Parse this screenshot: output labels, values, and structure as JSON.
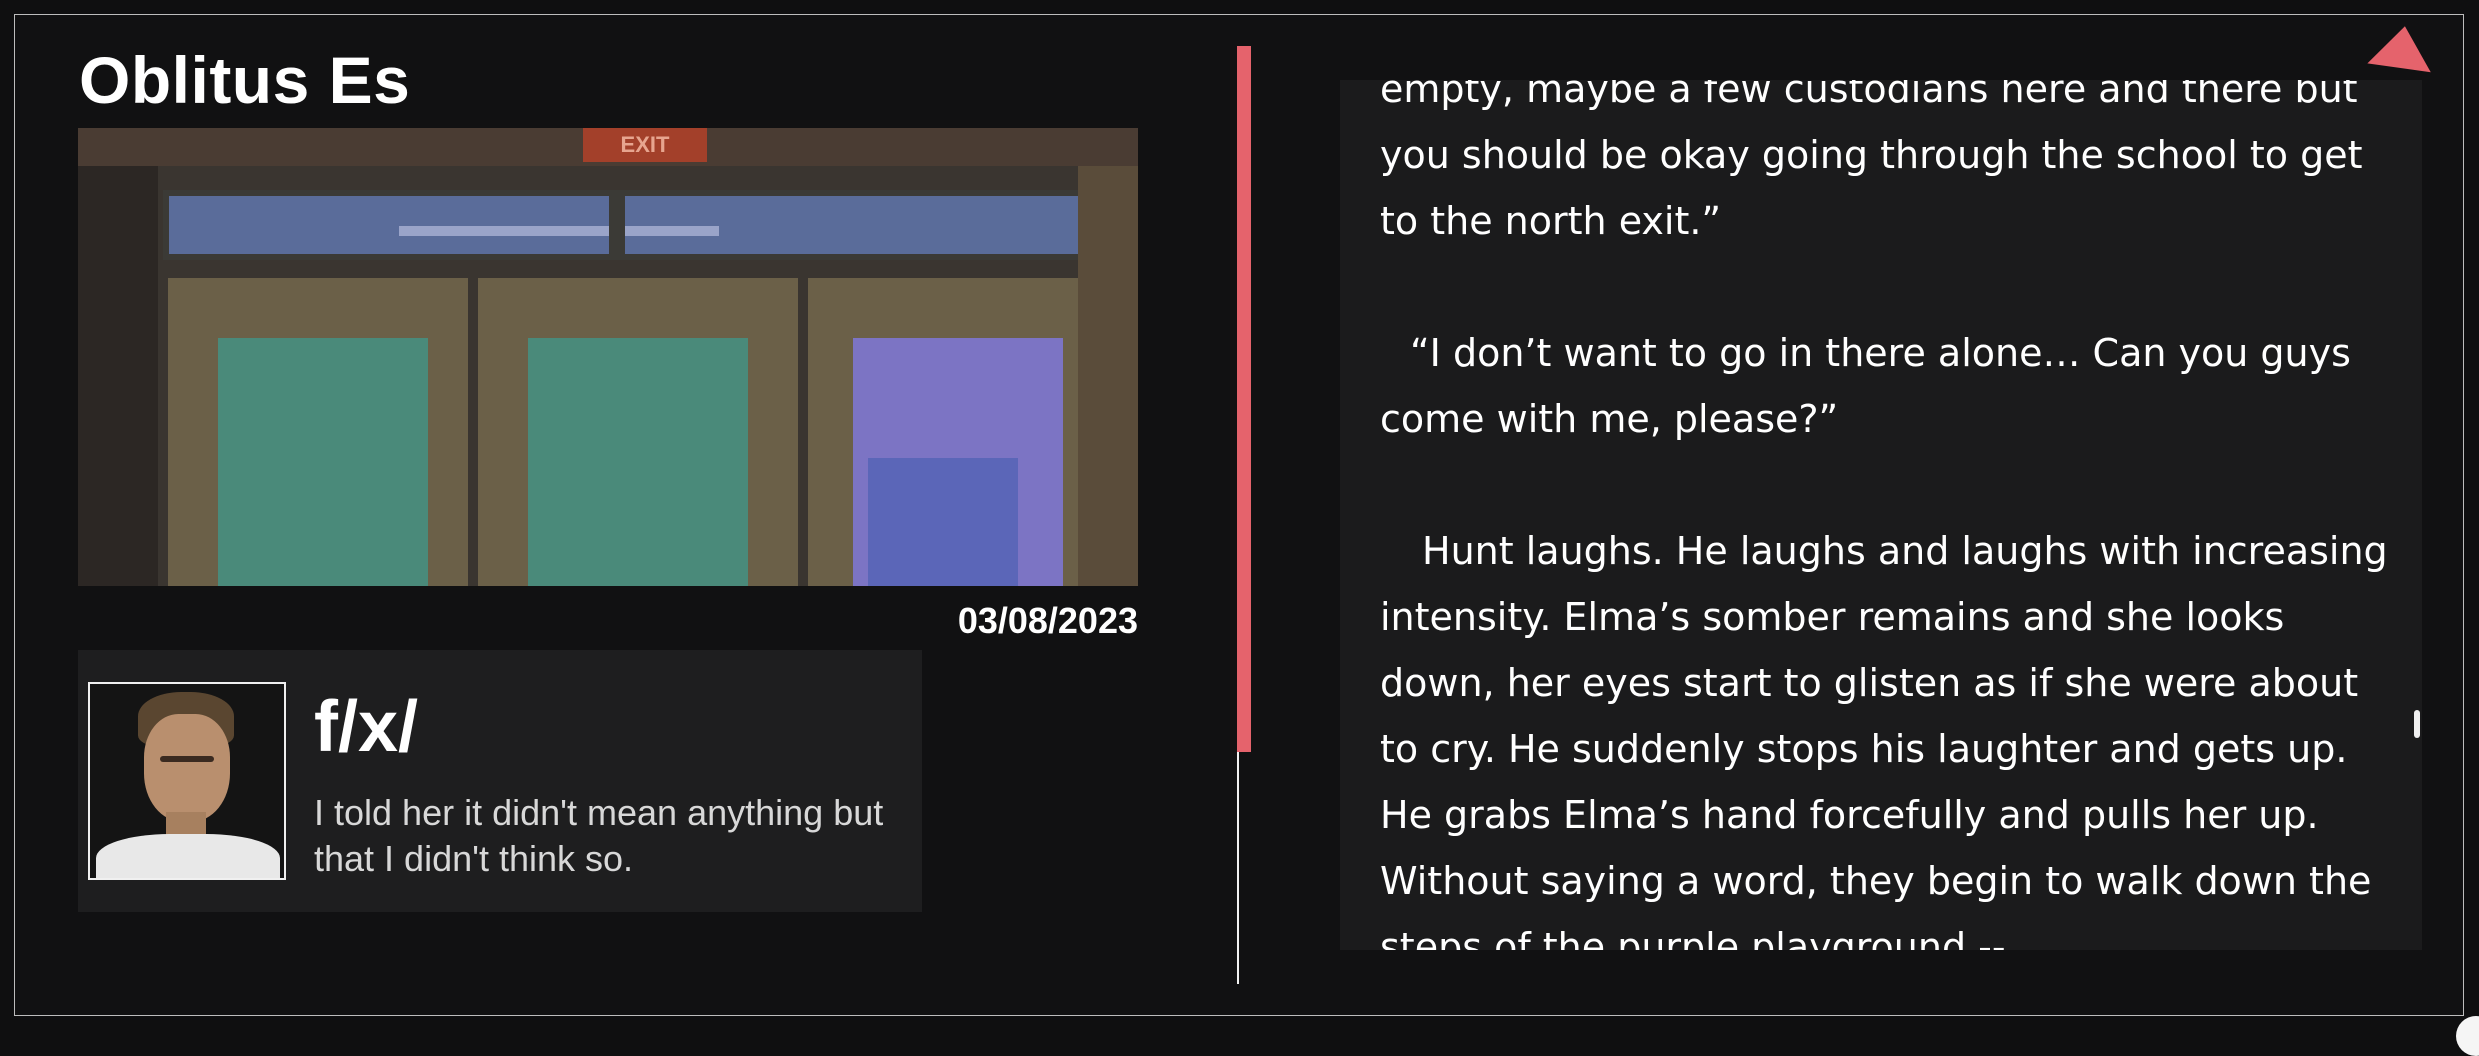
{
  "entry": {
    "title": "Oblitus Es",
    "date": "03/08/2023",
    "photo_sign": "EXIT"
  },
  "author": {
    "name": "f/x/",
    "quote": "I told her it didn't mean anything but that I didn't think so."
  },
  "story": {
    "paragraphs": [
      "empty, maybe a few custodians here and there but you should be okay going through the school to get to the north exit.”",
      "“I don’t want to go in there alone… Can you guys come with me, please?”",
      "Hunt laughs. He laughs and laughs with increasing intensity. Elma’s somber remains and she looks down, her eyes start to glisten as if she were about to cry. He suddenly stops his laughter and gets up. He grabs Elma’s hand forcefully and pulls her up. Without saying a word, they begin to walk down the steps of the purple playground --"
    ]
  },
  "colors": {
    "accent": "#e5636c",
    "background": "#111112",
    "panel": "#1b1b1c"
  },
  "icons": {
    "nav": "triangle-arrow-icon",
    "scroll": "scroll-thumb"
  }
}
